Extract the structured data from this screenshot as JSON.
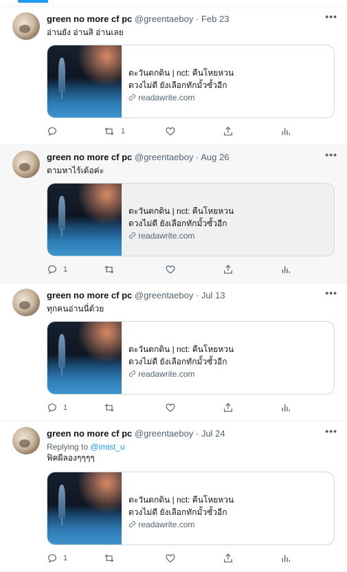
{
  "tweets": [
    {
      "name": "green no more cf pc",
      "handle": "@greentaeboy",
      "date": "Feb 23",
      "text": "อ่านยัง อ่านสิ อ่านเลย",
      "replying_prefix": "",
      "replying_handle": "",
      "card": {
        "title": "ตะวันตกดิน | nct: คืนโหยหวน",
        "description": "ดวงไม่ดี ยังเลือกทักมั้วซั้วอีก",
        "domain": "readawrite.com"
      },
      "replies": "",
      "retweets": "1",
      "likes": ""
    },
    {
      "name": "green no more cf pc",
      "handle": "@greentaeboy",
      "date": "Aug 26",
      "text": "ตามหาไร้เด้อค่ะ",
      "replying_prefix": "",
      "replying_handle": "",
      "card": {
        "title": "ตะวันตกดิน | nct: คืนโหยหวน",
        "description": "ดวงไม่ดี ยังเลือกทักมั้วซั้วอีก",
        "domain": "readawrite.com"
      },
      "replies": "1",
      "retweets": "",
      "likes": ""
    },
    {
      "name": "green no more cf pc",
      "handle": "@greentaeboy",
      "date": "Jul 13",
      "text": "ทุกคนอ่านนี่ด้วย",
      "replying_prefix": "",
      "replying_handle": "",
      "card": {
        "title": "ตะวันตกดิน | nct: คืนโหยหวน",
        "description": "ดวงไม่ดี ยังเลือกทักมั้วซั้วอีก",
        "domain": "readawrite.com"
      },
      "replies": "1",
      "retweets": "",
      "likes": ""
    },
    {
      "name": "green no more cf pc",
      "handle": "@greentaeboy",
      "date": "Jul 24",
      "text": "ฟิคผีลองๆๆๆๆ",
      "replying_prefix": "Replying to ",
      "replying_handle": "@imist_u",
      "card": {
        "title": "ตะวันตกดิน | nct: คืนโหยหวน",
        "description": "ดวงไม่ดี ยังเลือกทักมั้วซั้วอีก",
        "domain": "readawrite.com"
      },
      "replies": "1",
      "retweets": "",
      "likes": ""
    }
  ],
  "ui": {
    "separator": "·",
    "more": "•••"
  },
  "colors": {
    "accent": "#1d9bf0",
    "text": "#0f1419",
    "muted": "#536471",
    "border": "#cfd9de"
  }
}
